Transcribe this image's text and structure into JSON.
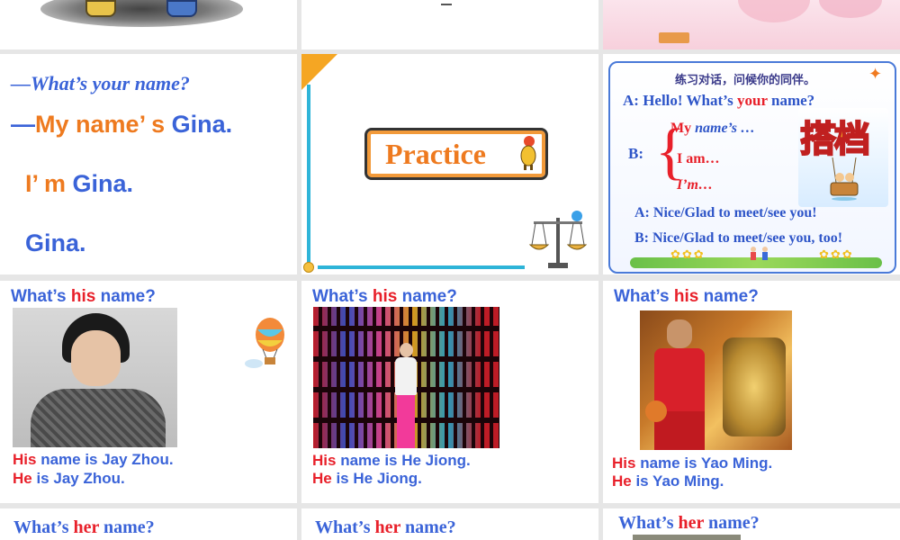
{
  "colors": {
    "blue": "#3a63d8",
    "orange": "#ee7a1f",
    "red": "#e8202a",
    "gray_bg": "#e6e6e6"
  },
  "slide_intro": {
    "q_dash": "—",
    "q_text": "What’s your name?",
    "a1_dash": "—",
    "a1_pre": "My ",
    "a1_name_word": "name",
    "a1_s": "’ s ",
    "a1_gina": "Gina.",
    "a2_im": "I’ m ",
    "a2_gina": "Gina.",
    "a3_gina": "Gina."
  },
  "slide_practice": {
    "title": "Practice"
  },
  "slide_dialog": {
    "instruction": "练习对话，问候你的同伴。",
    "a_prefix": "A: Hello! What’s ",
    "a_your": "your",
    "a_suffix": " name?",
    "b_label": "B:",
    "opt1_my": "My",
    "opt1_rest": " name’s …",
    "opt2": "I am…",
    "opt3": "I’m…",
    "a2": "A:  Nice/Glad to meet/see you!",
    "b2": "B:  Nice/Glad to meet/see you, too!",
    "badge": "搭档"
  },
  "slide_his1": {
    "q_pre": "What’s ",
    "q_his": "his",
    "q_post": " name?",
    "l1_his": "His",
    "l1_rest": " name is Jay Zhou.",
    "l2_he": "He",
    "l2_rest": " is Jay Zhou."
  },
  "slide_his2": {
    "q_pre": "What’s ",
    "q_his": "his",
    "q_post": " name?",
    "l1_his": "His",
    "l1_rest": " name is He Jiong.",
    "l2_he": "He",
    "l2_rest": " is He Jiong."
  },
  "slide_his3": {
    "q_pre": "What’s ",
    "q_his": "his",
    "q_post": " name?",
    "l1_his": "His",
    "l1_rest": " name is Yao Ming.",
    "l2_he": "He",
    "l2_rest": " is Yao Ming."
  },
  "slide_her1": {
    "q_pre": "What’s ",
    "q_her": "her",
    "q_post": " name?"
  },
  "slide_her2": {
    "q_pre": "What’s ",
    "q_her": "her",
    "q_post": " name?"
  },
  "slide_her3": {
    "q_pre": "What’s ",
    "q_her": "her",
    "q_post": " name?"
  }
}
